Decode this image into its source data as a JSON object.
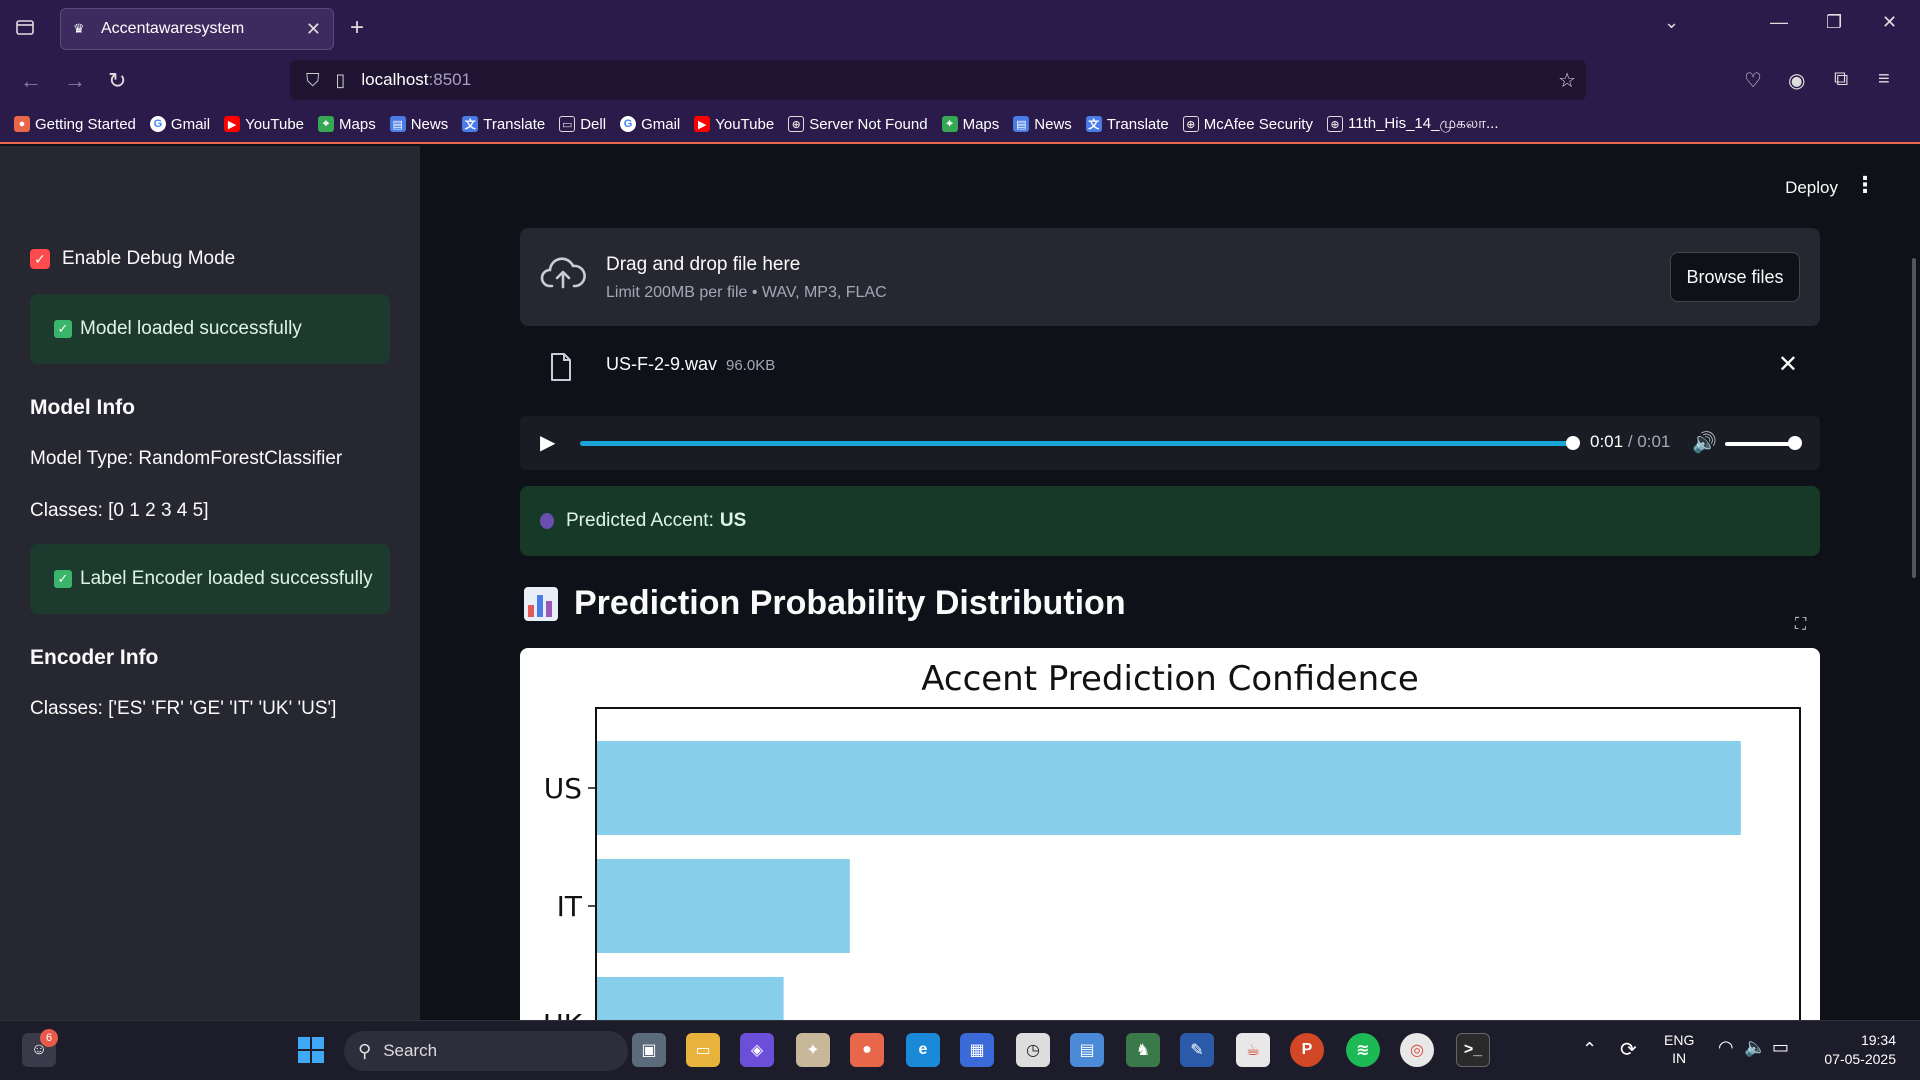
{
  "browser": {
    "tab_title": "Accentawaresystem",
    "url_host": "localhost",
    "url_port": ":8501",
    "bookmarks": [
      {
        "label": "Getting Started",
        "icon": "firefox-icon",
        "color": "#e8664a"
      },
      {
        "label": "Gmail",
        "icon": "google-icon",
        "color": "#ffffff"
      },
      {
        "label": "YouTube",
        "icon": "youtube-icon",
        "color": "#ff0000"
      },
      {
        "label": "Maps",
        "icon": "maps-icon",
        "color": "#34a853"
      },
      {
        "label": "News",
        "icon": "news-icon",
        "color": "#4a7ce8"
      },
      {
        "label": "Translate",
        "icon": "translate-icon",
        "color": "#4a7ce8"
      },
      {
        "label": "Dell",
        "icon": "folder-icon",
        "color": "#2b1b4a"
      },
      {
        "label": "Gmail",
        "icon": "google-icon",
        "color": "#ffffff"
      },
      {
        "label": "YouTube",
        "icon": "youtube-icon",
        "color": "#ff0000"
      },
      {
        "label": "Server Not Found",
        "icon": "globe-icon",
        "color": "#2b1b4a"
      },
      {
        "label": "Maps",
        "icon": "maps-icon",
        "color": "#34a853"
      },
      {
        "label": "News",
        "icon": "news-icon",
        "color": "#4a7ce8"
      },
      {
        "label": "Translate",
        "icon": "translate-icon",
        "color": "#4a7ce8"
      },
      {
        "label": "McAfee Security",
        "icon": "globe-icon",
        "color": "#2b1b4a"
      },
      {
        "label": "11th_His_14_முகலா...",
        "icon": "globe-icon",
        "color": "#2b1b4a"
      }
    ]
  },
  "header": {
    "deploy_label": "Deploy"
  },
  "sidebar": {
    "debug_label": "Enable Debug Mode",
    "model_loaded": "Model loaded successfully",
    "model_info_heading": "Model Info",
    "model_type": "Model Type: RandomForestClassifier",
    "model_classes": "Classes: [0 1 2 3 4 5]",
    "encoder_loaded": "Label Encoder loaded successfully",
    "encoder_info_heading": "Encoder Info",
    "encoder_classes": "Classes: ['ES' 'FR' 'GE' 'IT' 'UK' 'US']"
  },
  "uploader": {
    "title": "Drag and drop file here",
    "limit": "Limit 200MB per file • WAV, MP3, FLAC",
    "browse_label": "Browse files",
    "file_name": "US-F-2-9.wav",
    "file_size": "96.0KB"
  },
  "audio": {
    "current": "0:01",
    "separator": " / ",
    "duration": "0:01",
    "progress": 1.0
  },
  "prediction": {
    "label": "Predicted Accent:",
    "value": "US"
  },
  "section": {
    "title": "Prediction Probability Distribution"
  },
  "chart_data": {
    "type": "bar",
    "orientation": "horizontal",
    "title": "Accent Prediction Confidence",
    "categories": [
      "US",
      "IT",
      "UK"
    ],
    "values": [
      0.95,
      0.21,
      0.155
    ],
    "xlim": [
      0,
      1.0
    ],
    "bar_color": "#87ceeb"
  },
  "taskbar": {
    "search_label": "Search",
    "notification_count": "6",
    "lang_top": "ENG",
    "lang_bottom": "IN",
    "time": "19:34",
    "date": "07-05-2025"
  },
  "colors": {
    "accent": "#ff4b4b",
    "success_bg": "#1d3a2e",
    "chrome_bg": "#2b1b4a"
  }
}
